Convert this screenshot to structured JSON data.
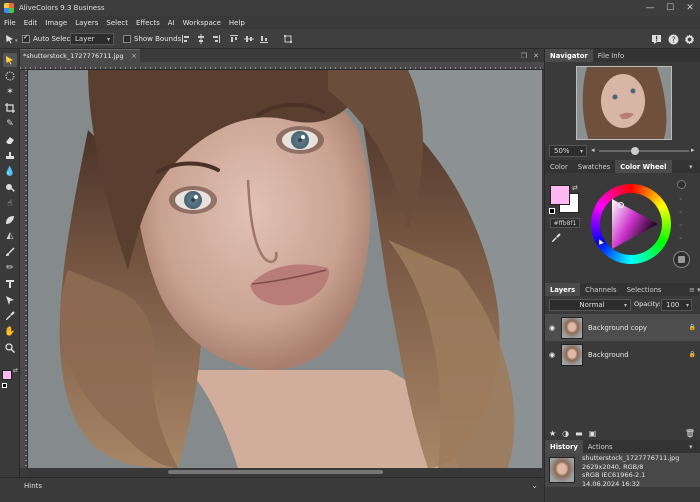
{
  "app": {
    "title": "AliveColors 9.3 Business"
  },
  "window_controls": {
    "minimize": "—",
    "maximize": "☐",
    "close": "✕"
  },
  "menu": [
    "File",
    "Edit",
    "Image",
    "Layers",
    "Select",
    "Effects",
    "AI",
    "Workspace",
    "Help"
  ],
  "options_bar": {
    "auto_select_label": "Auto Select",
    "auto_select_checked": true,
    "target_value": "Layer",
    "show_bounds_label": "Show Bounds",
    "show_bounds_checked": false
  },
  "document": {
    "tab_label": "*shutterstock_1727776711.jpg",
    "close_symbol": "×"
  },
  "status": {
    "hints_label": "Hints"
  },
  "colors": {
    "foreground": "#ffb8f1",
    "background": "#ffffff",
    "hex_value": "#ffb8f1",
    "accent_panel": "#4b4b4b"
  },
  "navigator": {
    "tabs": [
      "Navigator",
      "File Info"
    ],
    "zoom": "50%"
  },
  "color_panel": {
    "tabs": [
      "Color",
      "Swatches",
      "Color Wheel"
    ],
    "active_tab": "Color Wheel"
  },
  "layers_panel": {
    "tabs": [
      "Layers",
      "Channels",
      "Selections"
    ],
    "blend_mode": "Normal",
    "opacity_label": "Opacity:",
    "opacity_value": "100",
    "layers": [
      {
        "name": "Background copy",
        "selected": true
      },
      {
        "name": "Background",
        "selected": false
      }
    ]
  },
  "history_panel": {
    "tabs": [
      "History",
      "Actions"
    ],
    "file_info": [
      "shutterstock_1727776711.jpg",
      "2629x2040, RGB/8",
      "sRGB IEC61966-2.1",
      "14.06.2024 16:32"
    ]
  },
  "icons": {
    "move_tool": "move-tool-icon",
    "notification": "notification-icon",
    "help": "help-icon",
    "settings": "gear-icon"
  }
}
